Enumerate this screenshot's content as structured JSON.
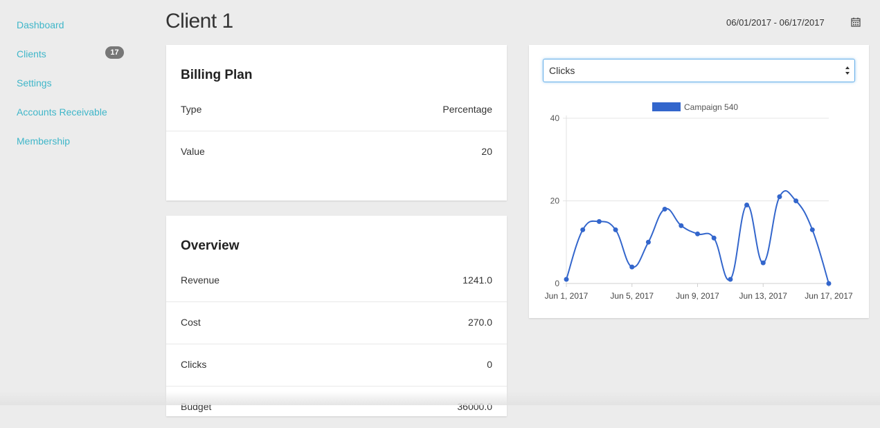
{
  "sidebar": {
    "items": [
      {
        "label": "Dashboard"
      },
      {
        "label": "Clients",
        "badge": "17"
      },
      {
        "label": "Settings"
      },
      {
        "label": "Accounts Receivable"
      },
      {
        "label": "Membership"
      }
    ]
  },
  "header": {
    "title": "Client 1",
    "date_range": "06/01/2017 - 06/17/2017",
    "calendar_icon": "calendar-icon"
  },
  "billing": {
    "title": "Billing Plan",
    "rows": [
      {
        "label": "Type",
        "value": "Percentage"
      },
      {
        "label": "Value",
        "value": "20"
      }
    ]
  },
  "overview": {
    "title": "Overview",
    "rows": [
      {
        "label": "Revenue",
        "value": "1241.0"
      },
      {
        "label": "Cost",
        "value": "270.0"
      },
      {
        "label": "Clicks",
        "value": "0"
      },
      {
        "label": "Budget",
        "value": "36000.0"
      }
    ]
  },
  "metric_select": {
    "value": "Clicks"
  },
  "chart_data": {
    "type": "line",
    "series": [
      {
        "name": "Campaign 540",
        "color": "#3366cc",
        "values": [
          1,
          13,
          15,
          13,
          4,
          10,
          18,
          14,
          12,
          11,
          1,
          19,
          5,
          21,
          20,
          13,
          0
        ]
      }
    ],
    "x": [
      "Jun 1, 2017",
      "Jun 2, 2017",
      "Jun 3, 2017",
      "Jun 4, 2017",
      "Jun 5, 2017",
      "Jun 6, 2017",
      "Jun 7, 2017",
      "Jun 8, 2017",
      "Jun 9, 2017",
      "Jun 10, 2017",
      "Jun 11, 2017",
      "Jun 12, 2017",
      "Jun 13, 2017",
      "Jun 14, 2017",
      "Jun 15, 2017",
      "Jun 16, 2017",
      "Jun 17, 2017"
    ],
    "x_tick_labels": [
      "Jun 1, 2017",
      "Jun 5, 2017",
      "Jun 9, 2017",
      "Jun 13, 2017",
      "Jun 17, 2017"
    ],
    "y_ticks": [
      "0",
      "20",
      "40"
    ],
    "ylim": [
      0,
      40
    ],
    "legend": "top",
    "grid": true
  }
}
